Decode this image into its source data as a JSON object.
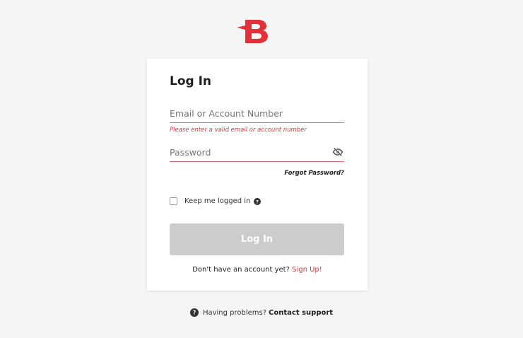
{
  "brand": {
    "logo_icon": "brand-b-logo",
    "accent_color": "#e3313a"
  },
  "login": {
    "title": "Log In",
    "email_placeholder": "Email or Account Number",
    "email_error": "Please enter a valid email or account number",
    "password_placeholder": "Password",
    "password_toggle_icon": "eye-off-icon",
    "forgot_password": "Forgot Password?",
    "keep_logged_in": "Keep me logged in",
    "submit_label": "Log In",
    "no_account_text": "Don't have an account yet?",
    "signup_label": "Sign Up!"
  },
  "footer": {
    "problems_text": "Having problems?",
    "support_label": "Contact support"
  }
}
